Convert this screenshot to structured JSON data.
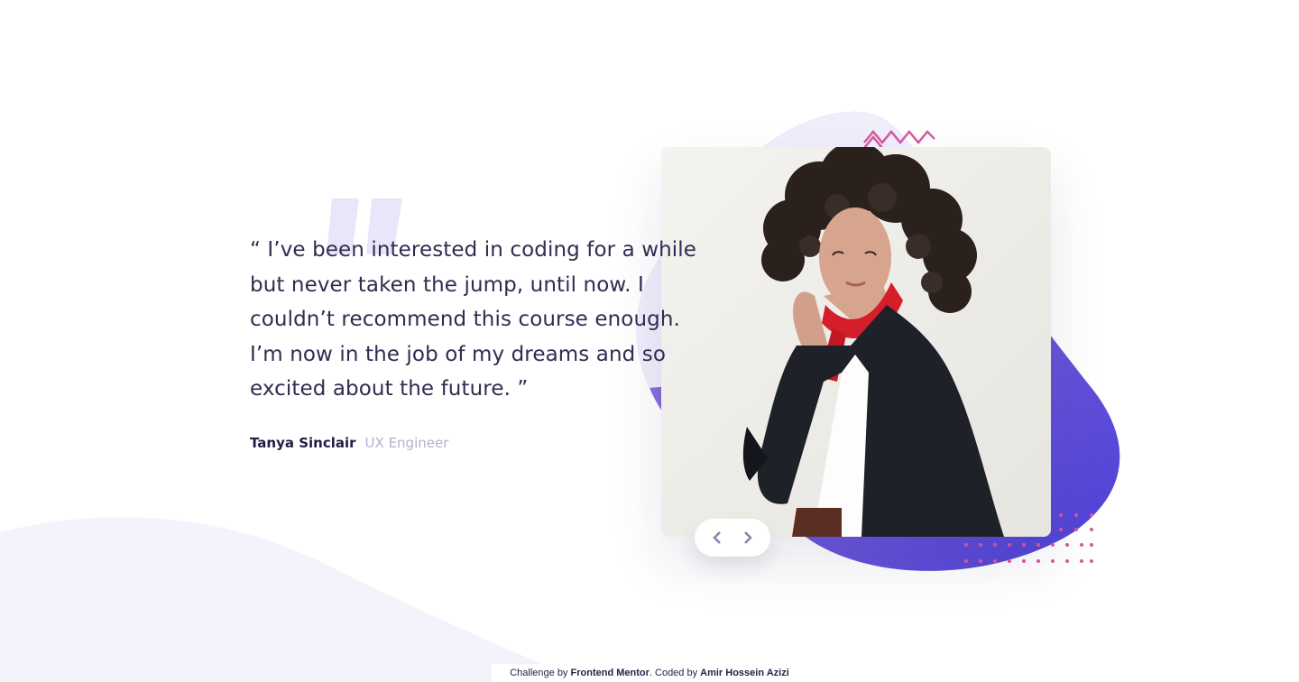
{
  "testimonial": {
    "quote": "“ I’ve been interested in coding for a while but never taken the jump, until now. I couldn’t recommend this course enough. I’m now in the job of my dreams and so excited about the future. ”",
    "author_name": "Tanya Sinclair",
    "author_role": "UX Engineer"
  },
  "navigation": {
    "prev_icon": "chevron-left-icon",
    "next_icon": "chevron-right-icon"
  },
  "footer": {
    "prefix": "Challenge by",
    "link_challenge": "Frontend Mentor",
    "middle": ". Coded by",
    "link_author": "Amir Hossein Azizi"
  },
  "colors": {
    "heading": "#202046",
    "role": "#b3b2cc",
    "accent_purple": "#6d5fd6",
    "accent_pink": "#d45aa0",
    "background_curve": "#f3f3fc",
    "quote_mark": "#e8e6f8"
  }
}
